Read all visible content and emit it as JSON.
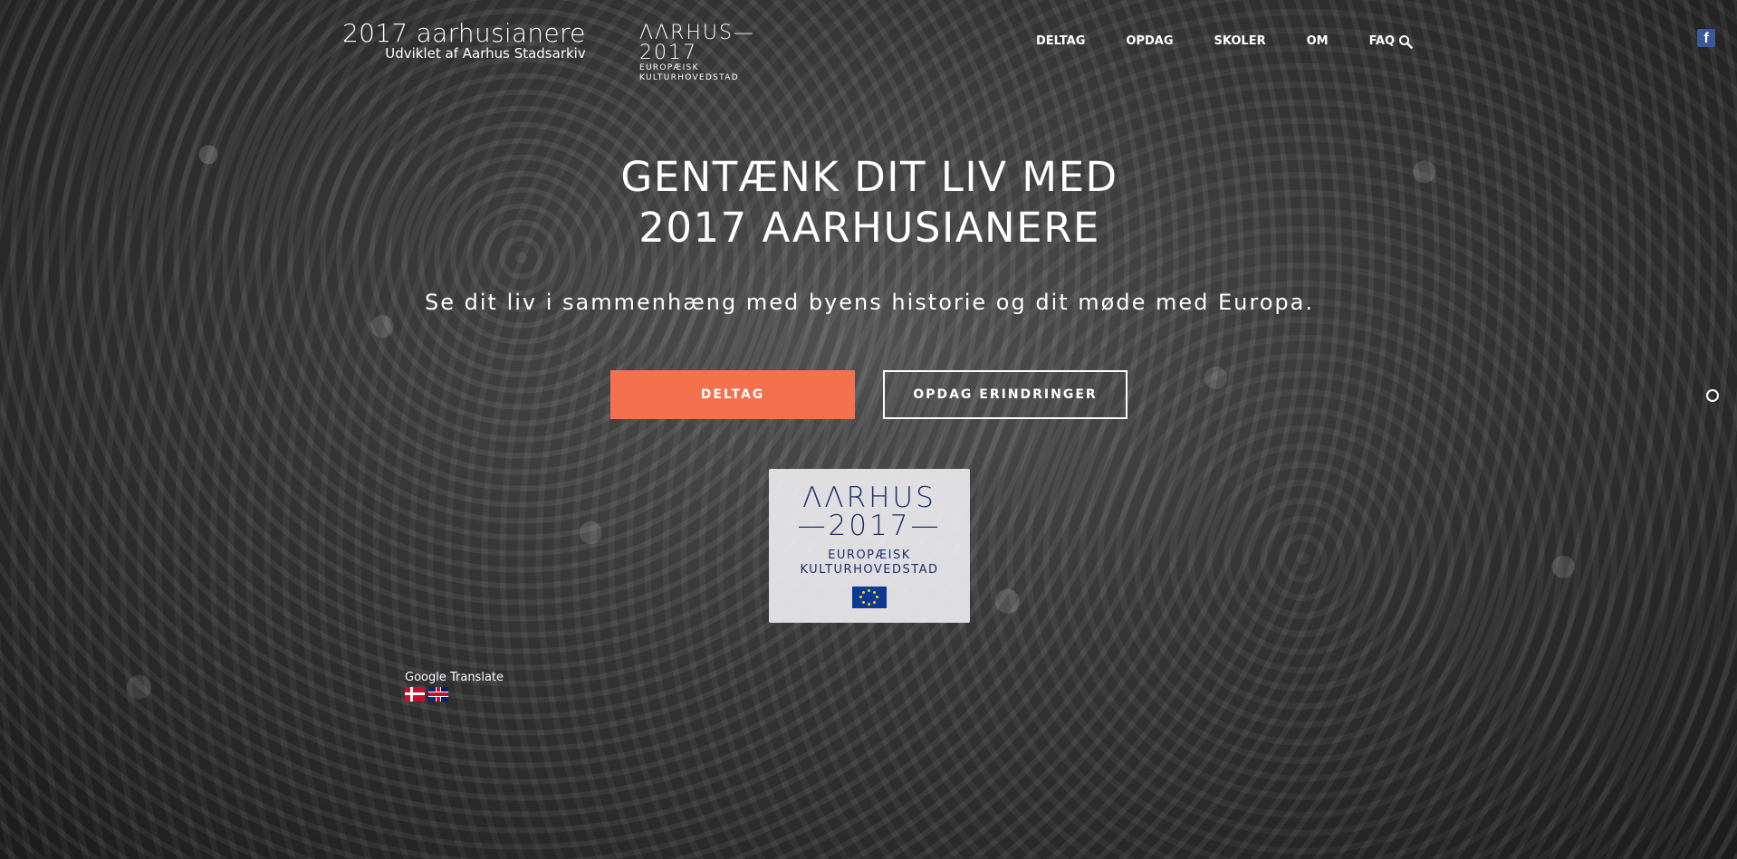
{
  "header": {
    "brand_title": "2017 aarhusianere",
    "brand_subtitle": "Udviklet af Aarhus Stadsarkiv",
    "logo_main": "ΛΛRHUS—2017",
    "logo_sub1": "EUROPÆISK",
    "logo_sub2": "KULTURHOVEDSTAD"
  },
  "nav": {
    "items": [
      {
        "label": "DELTAG"
      },
      {
        "label": "OPDAG"
      },
      {
        "label": "SKOLER"
      },
      {
        "label": "OM"
      },
      {
        "label": "FAQ"
      }
    ],
    "search_icon": "search-icon",
    "facebook_icon": "facebook-icon",
    "facebook_glyph": "f"
  },
  "hero": {
    "title_line1": "GENTÆNK DIT LIV MED",
    "title_line2": "2017 AARHUSIANERE",
    "subtitle": "Se dit liv i sammenhæng med byens historie og dit møde med Europa.",
    "primary_button": "DELTAG",
    "secondary_button": "OPDAG ERINDRINGER"
  },
  "badge": {
    "line1": "ΛΛRHUS",
    "line2": "—2017—",
    "line3": "EUROPÆISK",
    "line4": "KULTURHOVEDSTAD"
  },
  "translate": {
    "label": "Google Translate",
    "flags": [
      "danish-flag",
      "uk-flag"
    ]
  },
  "colors": {
    "accent": "#f5704d",
    "badge_text": "#1d2c6a",
    "facebook": "#3b5998"
  }
}
